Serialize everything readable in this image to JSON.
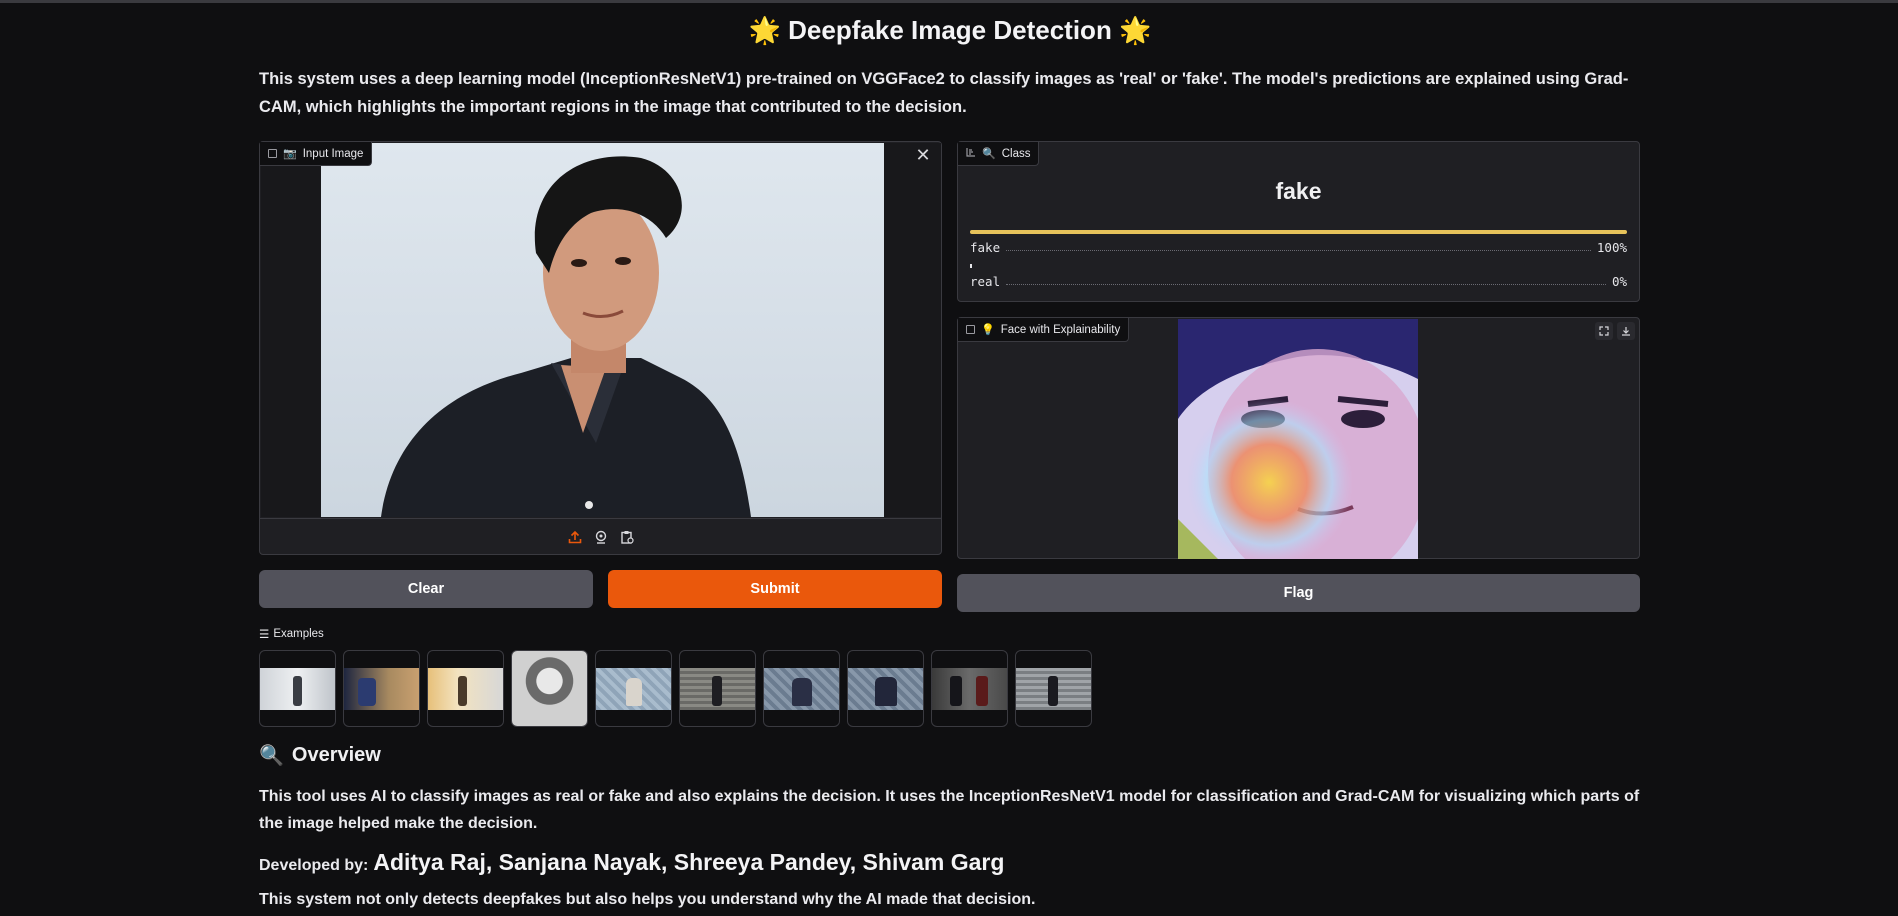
{
  "header": {
    "title": "Deepfake Image Detection",
    "title_emoji": "🌟",
    "intro": "This system uses a deep learning model (InceptionResNetV1) pre-trained on VGGFace2 to classify images as 'real' or 'fake'. The model's predictions are explained using Grad-CAM, which highlights the important regions in the image that contributed to the decision."
  },
  "input": {
    "label": "Input Image",
    "label_icon": "camera-icon",
    "close_icon": "close-icon",
    "toolbar_icons": [
      "upload-icon",
      "webcam-icon",
      "clipboard-icon"
    ]
  },
  "buttons": {
    "clear": "Clear",
    "submit": "Submit",
    "flag": "Flag"
  },
  "class_output": {
    "label": "Class",
    "label_icon": "magnifier-icon",
    "prediction": "fake",
    "confidences": [
      {
        "label": "fake",
        "value": "100%",
        "fraction": 1.0
      },
      {
        "label": "real",
        "value": "0%",
        "fraction": 0.0
      }
    ],
    "bar_color": "#e6c25a"
  },
  "explain_output": {
    "label": "Face with Explainability",
    "label_icon": "lightbulb-icon",
    "action_icons": [
      "fullscreen-icon",
      "download-icon"
    ]
  },
  "examples": {
    "label": "Examples",
    "count": 10
  },
  "overview": {
    "title": "Overview",
    "title_icon": "magnifier-icon",
    "text": "This tool uses AI to classify images as real or fake and also explains the decision. It uses the InceptionResNetV1 model for classification and Grad-CAM for visualizing which parts of the image helped make the decision.",
    "developed_by_label": "Developed by:",
    "developers": "Aditya Raj, Sanjana Nayak, Shreeya Pandey, Shivam Garg",
    "closing": "This system not only detects deepfakes but also helps you understand why the AI made that decision."
  },
  "colors": {
    "background": "#0f0f11",
    "panel": "#1f1f23",
    "accent": "#ea580c",
    "secondary_button": "#52525b"
  }
}
